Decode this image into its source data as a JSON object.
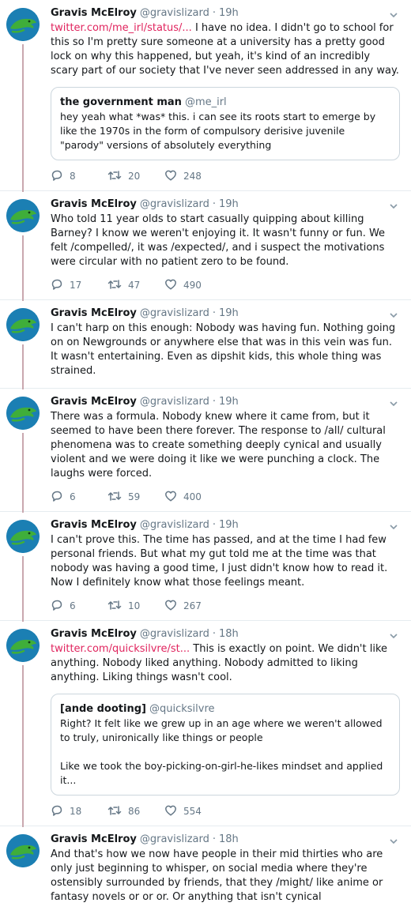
{
  "author": {
    "name": "Gravis McElroy",
    "handle": "@gravislizard"
  },
  "tweets": [
    {
      "time": "19h",
      "link": "twitter.com/me_irl/status/...",
      "text": "I have no idea. I didn't go to school for this so I'm pretty sure someone at a university has a pretty good lock on why this happened, but yeah, it's kind of an incredibly scary part of our society that I've never seen addressed in any way.",
      "quote": {
        "name": "the government man",
        "handle": "@me_irl",
        "text": "hey yeah what *was* this. i can see its roots start to emerge by like the 1970s in the form of compulsory derisive juvenile \"parody\" versions of absolutely everything"
      },
      "replies": "8",
      "retweets": "20",
      "likes": "248"
    },
    {
      "time": "19h",
      "text": "Who told 11 year olds to start casually quipping about killing Barney? I know we weren't enjoying it. It wasn't funny or fun. We felt /compelled/, it was /expected/, and i suspect the motivations were circular with no patient zero to be found.",
      "replies": "17",
      "retweets": "47",
      "likes": "490"
    },
    {
      "time": "19h",
      "text": "I can't harp on this enough: Nobody was having fun. Nothing going on on Newgrounds or anywhere else that was in this vein was fun. It wasn't entertaining. Even as dipshit kids, this whole thing was strained."
    },
    {
      "time": "19h",
      "text": "There was a formula. Nobody knew where it came from, but it seemed to have been there forever. The response to /all/ cultural phenomena was to create something deeply cynical and usually violent and we were doing it like we were punching a clock. The laughs were forced.",
      "replies": "6",
      "retweets": "59",
      "likes": "400"
    },
    {
      "time": "19h",
      "text": "I can't prove this. The time has passed, and at the time I had few personal friends. But what my gut told me at the time was that nobody was having a good time, I just didn't know how to read it. Now I definitely know what those feelings meant.",
      "replies": "6",
      "retweets": "10",
      "likes": "267"
    },
    {
      "time": "18h",
      "link": "twitter.com/quicksilvre/st...",
      "text": "This is exactly on point. We didn't like anything. Nobody liked anything. Nobody admitted to liking anything. Liking things wasn't cool.",
      "quote": {
        "name": "[ande dooting]",
        "handle": "@quicksilvre",
        "text": "Right? It felt like we grew up in an age where we weren't allowed to truly, unironically like things or people",
        "text2": "Like we took the boy-picking-on-girl-he-likes mindset and applied it..."
      },
      "replies": "18",
      "retweets": "86",
      "likes": "554"
    },
    {
      "time": "18h",
      "text": "And that's how we now have people in their mid thirties who are only just beginning to whisper, on social media where they're ostensibly surrounded by friends, that they /might/ like anime or fantasy novels or or or. Or anything that isn't cynical"
    }
  ],
  "colors": {
    "link": "#e0245e",
    "secondary": "#657786",
    "thread_line": "#c9a8af",
    "avatar_bg": "#1b7fb3",
    "lizard": "#3fae3a"
  },
  "icons": {
    "reply": "reply-icon",
    "retweet": "retweet-icon",
    "like": "heart-icon",
    "menu": "chevron-down-icon",
    "avatar": "lizard-avatar"
  }
}
